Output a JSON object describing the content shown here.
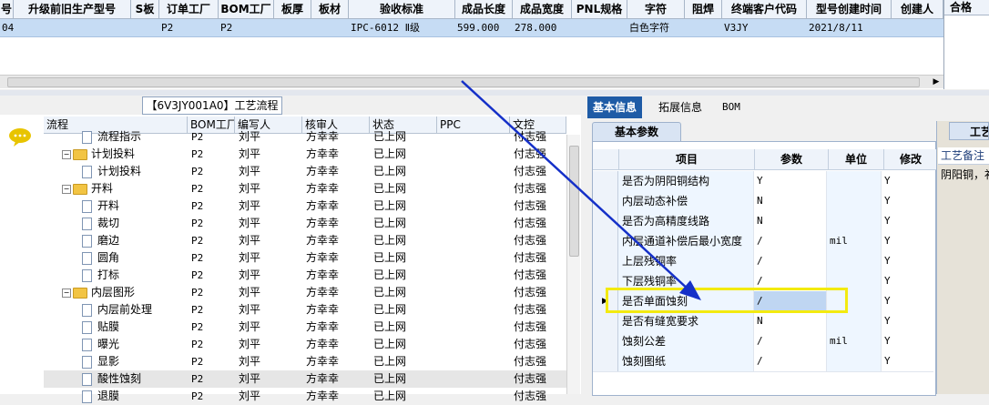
{
  "top_grid": {
    "headers": [
      "号",
      "升级前旧生产型号",
      "S板",
      "订单工厂",
      "BOM工厂",
      "板厚",
      "板材",
      "验收标准",
      "成品长度",
      "成品宽度",
      "PNL规格",
      "字符",
      "阻焊",
      "终端客户代码",
      "型号创建时间",
      "创建人"
    ],
    "row": [
      "04",
      "",
      "",
      "P2",
      "P2",
      "",
      "",
      "IPC-6012 Ⅱ级",
      "599.000",
      "278.000",
      "",
      "白色字符",
      "",
      "V3JY",
      "2021/8/11",
      ""
    ]
  },
  "right_top": {
    "header": "合格"
  },
  "left": {
    "title": "【6V3JY001A0】工艺流程",
    "tree_headers": [
      "流程",
      "BOM工厂",
      "编写人",
      "核审人",
      "状态",
      "PPC",
      "文控"
    ],
    "rows": [
      {
        "name": "流程指示",
        "kind": "doc",
        "level": 2,
        "bom": "P2",
        "writer": "刘平",
        "reviewer": "方幸幸",
        "status": "已上网",
        "doc": "付志强"
      },
      {
        "name": "计划投料",
        "kind": "folder",
        "level": 1,
        "bom": "P2",
        "writer": "刘平",
        "reviewer": "方幸幸",
        "status": "已上网",
        "doc": "付志强"
      },
      {
        "name": "计划投料",
        "kind": "doc",
        "level": 2,
        "bom": "P2",
        "writer": "刘平",
        "reviewer": "方幸幸",
        "status": "已上网",
        "doc": "付志强"
      },
      {
        "name": "开料",
        "kind": "folder",
        "level": 1,
        "bom": "P2",
        "writer": "刘平",
        "reviewer": "方幸幸",
        "status": "已上网",
        "doc": "付志强"
      },
      {
        "name": "开料",
        "kind": "doc",
        "level": 2,
        "bom": "P2",
        "writer": "刘平",
        "reviewer": "方幸幸",
        "status": "已上网",
        "doc": "付志强"
      },
      {
        "name": "裁切",
        "kind": "doc",
        "level": 2,
        "bom": "P2",
        "writer": "刘平",
        "reviewer": "方幸幸",
        "status": "已上网",
        "doc": "付志强"
      },
      {
        "name": "磨边",
        "kind": "doc",
        "level": 2,
        "bom": "P2",
        "writer": "刘平",
        "reviewer": "方幸幸",
        "status": "已上网",
        "doc": "付志强"
      },
      {
        "name": "圆角",
        "kind": "doc",
        "level": 2,
        "bom": "P2",
        "writer": "刘平",
        "reviewer": "方幸幸",
        "status": "已上网",
        "doc": "付志强"
      },
      {
        "name": "打标",
        "kind": "doc",
        "level": 2,
        "bom": "P2",
        "writer": "刘平",
        "reviewer": "方幸幸",
        "status": "已上网",
        "doc": "付志强"
      },
      {
        "name": "内层图形",
        "kind": "folder",
        "level": 1,
        "bom": "P2",
        "writer": "刘平",
        "reviewer": "方幸幸",
        "status": "已上网",
        "doc": "付志强"
      },
      {
        "name": "内层前处理",
        "kind": "doc",
        "level": 2,
        "bom": "P2",
        "writer": "刘平",
        "reviewer": "方幸幸",
        "status": "已上网",
        "doc": "付志强"
      },
      {
        "name": "贴膜",
        "kind": "doc",
        "level": 2,
        "bom": "P2",
        "writer": "刘平",
        "reviewer": "方幸幸",
        "status": "已上网",
        "doc": "付志强"
      },
      {
        "name": "曝光",
        "kind": "doc",
        "level": 2,
        "bom": "P2",
        "writer": "刘平",
        "reviewer": "方幸幸",
        "status": "已上网",
        "doc": "付志强"
      },
      {
        "name": "显影",
        "kind": "doc",
        "level": 2,
        "bom": "P2",
        "writer": "刘平",
        "reviewer": "方幸幸",
        "status": "已上网",
        "doc": "付志强"
      },
      {
        "name": "酸性蚀刻",
        "kind": "doc",
        "level": 2,
        "bom": "P2",
        "writer": "刘平",
        "reviewer": "方幸幸",
        "status": "已上网",
        "doc": "付志强"
      },
      {
        "name": "退膜",
        "kind": "doc",
        "level": 2,
        "bom": "P2",
        "writer": "刘平",
        "reviewer": "方幸幸",
        "status": "已上网",
        "doc": "付志强"
      }
    ]
  },
  "tabs": [
    "基本信息",
    "拓展信息",
    "BOM"
  ],
  "subtab": "基本参数",
  "param_headers": [
    "项目",
    "参数",
    "单位",
    "修改"
  ],
  "params": [
    {
      "item": "是否为阴阳铜结构",
      "value": "Y",
      "unit": "",
      "mod": "Y"
    },
    {
      "item": "内层动态补偿",
      "value": "N",
      "unit": "",
      "mod": "Y"
    },
    {
      "item": "是否为高精度线路",
      "value": "N",
      "unit": "",
      "mod": "Y"
    },
    {
      "item": "内层通道补偿后最小宽度",
      "value": "/",
      "unit": "mil",
      "mod": "Y"
    },
    {
      "item": "上层残铜率",
      "value": "/",
      "unit": "",
      "mod": "Y"
    },
    {
      "item": "下层残铜率",
      "value": "/",
      "unit": "",
      "mod": "Y"
    },
    {
      "item": "是否单面蚀刻",
      "value": "/",
      "unit": "",
      "mod": "Y"
    },
    {
      "item": "是否有缝宽要求",
      "value": "N",
      "unit": "",
      "mod": "Y"
    },
    {
      "item": "蚀刻公差",
      "value": "/",
      "unit": "mil",
      "mod": "Y"
    },
    {
      "item": "蚀刻图纸",
      "value": "/",
      "unit": "",
      "mod": "Y"
    }
  ],
  "craft": {
    "tab": "工艺",
    "header": "工艺备注",
    "value": "阴阳铜，补"
  },
  "colors": {
    "accent": "#1e5ba6",
    "highlight": "#f3ea10",
    "arrow": "#1530c8",
    "selected_row": "#c6dcf4"
  }
}
